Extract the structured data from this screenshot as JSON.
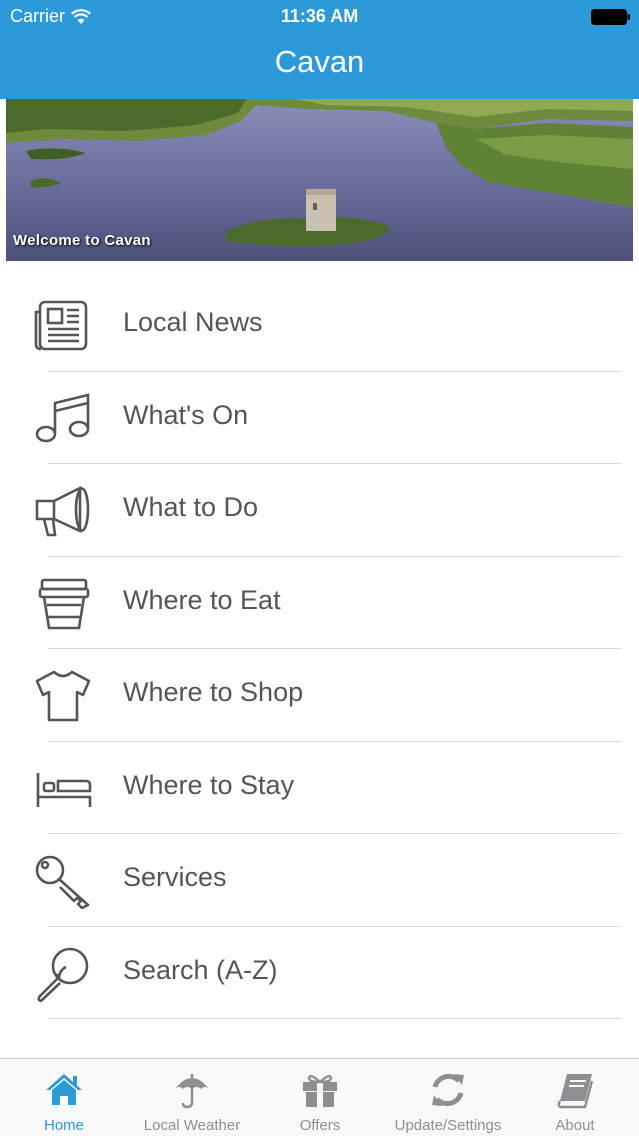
{
  "status_bar": {
    "carrier": "Carrier",
    "time": "11:36 AM"
  },
  "header": {
    "title": "Cavan"
  },
  "banner": {
    "caption": "Welcome to Cavan"
  },
  "menu": {
    "items": [
      {
        "label": "Local News",
        "icon": "newspaper-icon"
      },
      {
        "label": "What's On",
        "icon": "music-note-icon"
      },
      {
        "label": "What to Do",
        "icon": "megaphone-icon"
      },
      {
        "label": "Where to Eat",
        "icon": "coffee-cup-icon"
      },
      {
        "label": "Where to Shop",
        "icon": "tshirt-icon"
      },
      {
        "label": "Where to Stay",
        "icon": "bed-icon"
      },
      {
        "label": "Services",
        "icon": "key-icon"
      },
      {
        "label": "Search (A-Z)",
        "icon": "magnifier-icon"
      }
    ]
  },
  "tabbar": {
    "active_color": "#2c9ad8",
    "inactive_color": "#8e8e93",
    "tabs": [
      {
        "label": "Home",
        "icon": "home-icon",
        "active": true
      },
      {
        "label": "Local Weather",
        "icon": "umbrella-icon",
        "active": false
      },
      {
        "label": "Offers",
        "icon": "gift-icon",
        "active": false
      },
      {
        "label": "Update/Settings",
        "icon": "refresh-icon",
        "active": false
      },
      {
        "label": "About",
        "icon": "book-icon",
        "active": false
      }
    ]
  },
  "colors": {
    "header": "#2c9ad8",
    "text": "#555558",
    "separator": "#d8d8dc"
  }
}
